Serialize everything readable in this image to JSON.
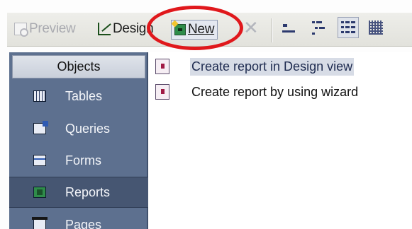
{
  "toolbar": {
    "preview_label": "Preview",
    "design_label": "Design",
    "new_label": "New",
    "delete_icon": "delete-x-icon",
    "view_icons": [
      "large-icons-view-icon",
      "small-icons-view-icon",
      "list-view-icon",
      "details-view-icon"
    ]
  },
  "objects_bar": {
    "header": "Objects",
    "items": [
      {
        "label": "Tables",
        "icon": "table-icon"
      },
      {
        "label": "Queries",
        "icon": "query-icon"
      },
      {
        "label": "Forms",
        "icon": "form-icon"
      },
      {
        "label": "Reports",
        "icon": "report-icon",
        "selected": true
      },
      {
        "label": "Pages",
        "icon": "page-icon"
      }
    ]
  },
  "list": {
    "items": [
      {
        "label": "Create report in Design view",
        "highlighted": true
      },
      {
        "label": "Create report by using wizard",
        "highlighted": false
      }
    ]
  },
  "colors": {
    "annotation": "#e0181c",
    "objects_bar_bg": "#5d708f",
    "selection": "#d7dce6"
  }
}
